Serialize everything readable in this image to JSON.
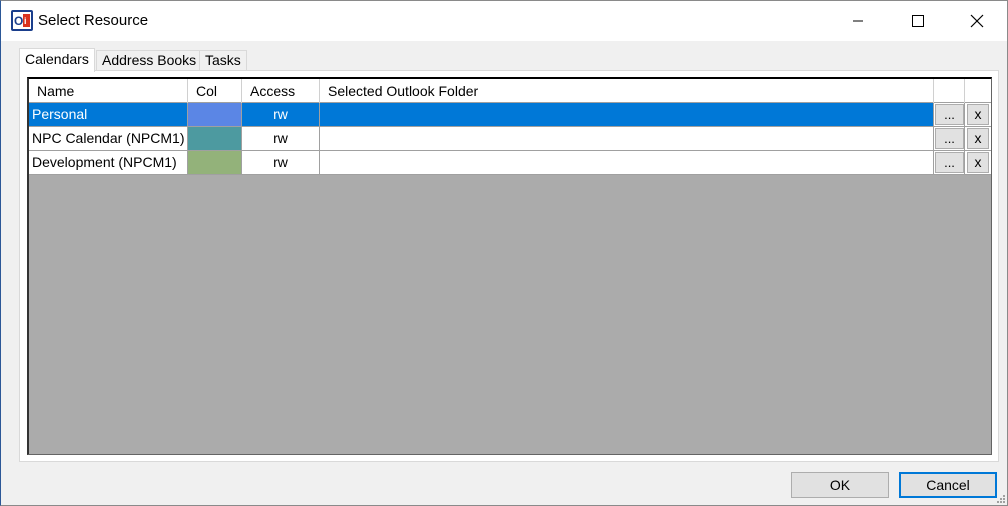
{
  "window": {
    "title": "Select Resource",
    "app_icon": "outlook-sync-icon"
  },
  "tabs": [
    {
      "label": "Calendars",
      "active": true
    },
    {
      "label": "Address Books",
      "active": false
    },
    {
      "label": "Tasks",
      "active": false
    }
  ],
  "grid": {
    "columns": [
      "Name",
      "Col",
      "Access",
      "Selected Outlook Folder",
      "",
      ""
    ],
    "rows": [
      {
        "name": "Personal",
        "color": "#5b86e5",
        "access": "rw",
        "folder": "",
        "browse": "...",
        "clear": "x",
        "selected": true
      },
      {
        "name": "NPC Calendar (NPCM1)",
        "color": "#4d9aa0",
        "access": "rw",
        "folder": "",
        "browse": "...",
        "clear": "x",
        "selected": false
      },
      {
        "name": "Development (NPCM1)",
        "color": "#93b27a",
        "access": "rw",
        "folder": "",
        "browse": "...",
        "clear": "x",
        "selected": false
      }
    ]
  },
  "buttons": {
    "ok": "OK",
    "cancel": "Cancel"
  },
  "colors": {
    "selection": "#0078d7",
    "grid_background": "#ababab"
  }
}
